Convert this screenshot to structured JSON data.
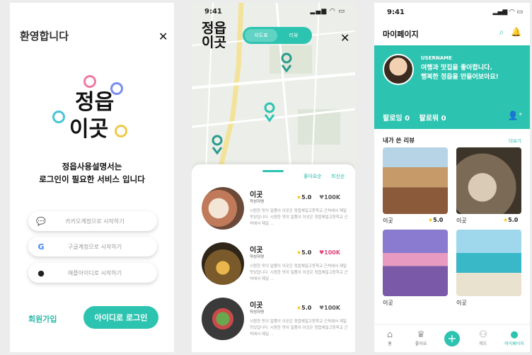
{
  "welcome": {
    "title": "환영합니다",
    "close": "✕",
    "logo_lines": [
      "정읍",
      "이곳"
    ],
    "message_line1": "정읍사용설명서는",
    "message_line2": "로그인이 필요한 서비스 입니다",
    "kakao_label": "카카오계정으로 시작하기",
    "google_label": "구글계정으로 시작하기",
    "apple_label": "애플아이디로 시작하기",
    "signup_label": "회원가입",
    "login_label": "아이디로 로그인"
  },
  "map_screen": {
    "time": "9:41",
    "signal": "▂▄▆ ◠ ▭",
    "logo_lines": [
      "정읍",
      "이곳"
    ],
    "seg_left": "지도표",
    "seg_right": "리뷰",
    "close": "✕",
    "sort_popular": "좋아요순",
    "sort_recent": "최신순",
    "cards": [
      {
        "name": "이곳",
        "sub": "작성자명",
        "rating": "5.0",
        "likes": "100K",
        "desc": "시원한 맛이 일품이 이곳은 정읍체일고등학교 근처에서 제일 맛있답니다. 시원한 맛이 일품이 이곳은 정읍체일고등학교 근처에서 제일 ..."
      },
      {
        "name": "이곳",
        "sub": "작성자명",
        "rating": "5.0",
        "likes": "100K",
        "desc": "시원한 맛이 일품이 이곳은 정읍체일고등학교 근처에서 제일 맛있답니다. 시원한 맛이 일품이 이곳은 정읍체일고등학교 근처에서 제일 ..."
      },
      {
        "name": "이곳",
        "sub": "작성자명",
        "rating": "5.0",
        "likes": "100K",
        "desc": "시원한 맛이 일품이 이곳은 정읍체일고등학교 근처에서 제일 맛있답니다. 시원한 맛이 일품이 이곳은 정읍체일고등학교 근처에서 제일 ..."
      }
    ]
  },
  "mypage": {
    "time": "9:41",
    "signal": "▂▄▆ ◠ ▭",
    "title": "마이페이지",
    "username": "USERNAME",
    "bio_line1": "여행과 맛집을 좋아합니다.",
    "bio_line2": "행복한 정읍을 만들어보아요!",
    "following": "팔로잉 0",
    "followers": "팔로워 0",
    "reviews_heading": "내가 쓴 리뷰",
    "more": "더보기",
    "tiles": [
      {
        "caption": "이곳",
        "rating": "5.0"
      },
      {
        "caption": "이곳",
        "rating": "5.0"
      },
      {
        "caption": "이곳",
        "rating": ""
      },
      {
        "caption": "이곳",
        "rating": ""
      }
    ],
    "nav": [
      "홈",
      "좋아요",
      "",
      "피드",
      "마이페이지"
    ]
  },
  "colors": {
    "accent": "#2cc4b0",
    "heart": "#e0457b",
    "star": "#f5c518"
  }
}
